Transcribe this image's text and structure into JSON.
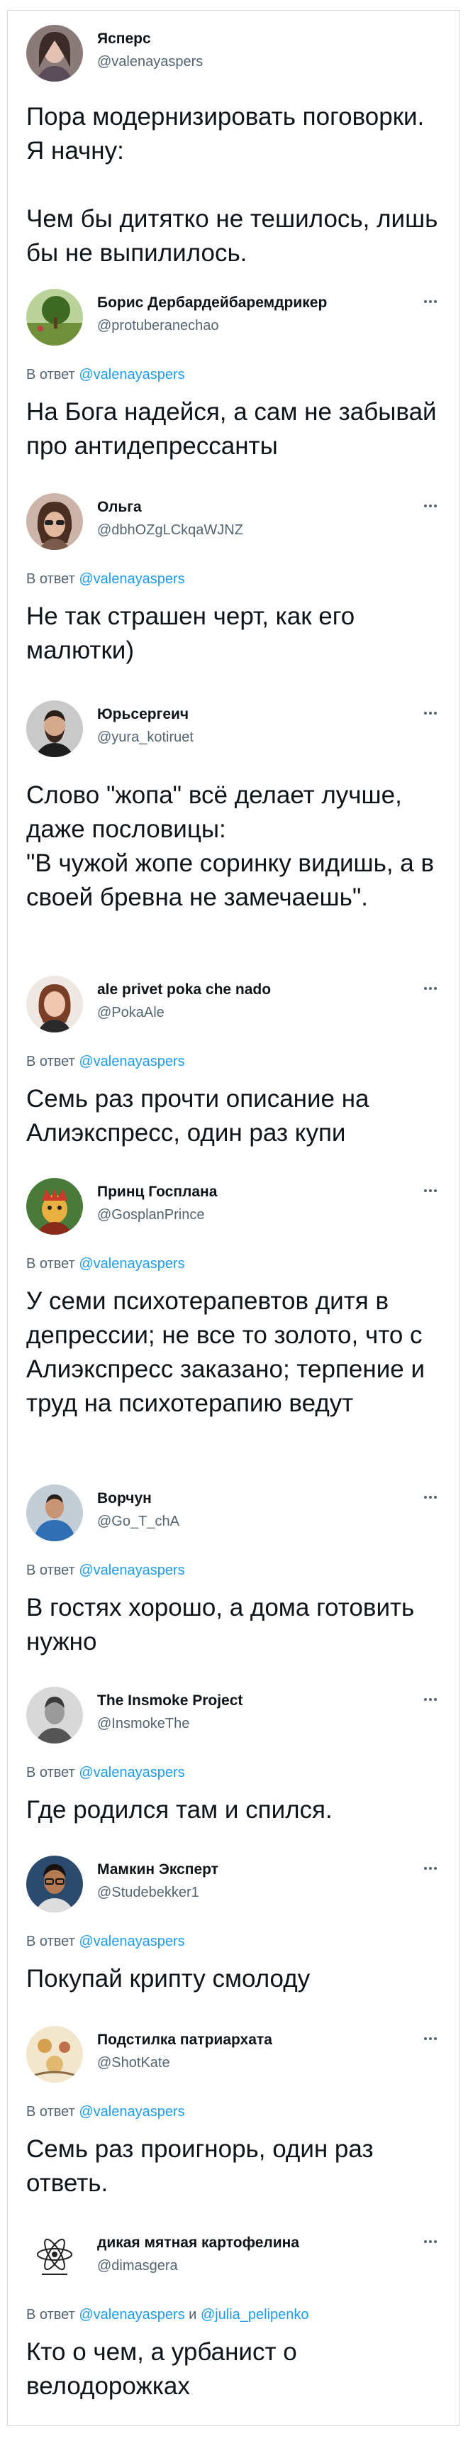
{
  "reply_prefix": "В ответ",
  "main_tweet": {
    "name": "Ясперс",
    "handle": "@valenayaspers",
    "text": "Пора модернизировать поговорки. Я начну:\n\nЧем бы дитятко не тешилось, лишь бы не выпилилось."
  },
  "replies": [
    {
      "name": "Борис Дербардейбаремдрикер",
      "handle": "@protuberanechao",
      "reply_to": "@valenayaspers",
      "text": "На Бога надейся, а сам не забывай про антидепрессанты"
    },
    {
      "name": "Ольга",
      "handle": "@dbhOZgLCkqaWJNZ",
      "reply_to": "@valenayaspers",
      "text": "Не так страшен черт, как его малютки)"
    },
    {
      "name": "Юрьсергеич",
      "handle": "@yura_kotiruet",
      "reply_to": "",
      "text": "Слово \"жопа\" всё делает лучше, даже пословицы:\n\"В чужой жопе соринку видишь, а в своей бревна не замечаешь\"."
    },
    {
      "name": "ale privet poka che nado",
      "handle": "@PokaAle",
      "reply_to": "@valenayaspers",
      "text": "Семь раз прочти описание на Алиэкспресс, один раз купи"
    },
    {
      "name": "Принц Госплана",
      "handle": "@GosplanPrince",
      "reply_to": "@valenayaspers",
      "text": "У семи психотерапевтов дитя в депрессии; не все то золото, что с Алиэкспресс заказано; терпение и труд на психотерапию ведут"
    },
    {
      "name": "Ворчун",
      "handle": "@Go_T_chA",
      "reply_to": "@valenayaspers",
      "text": "В гостях хорошо, а дома готовить нужно"
    },
    {
      "name": "The Insmoke Project",
      "handle": "@InsmokeThe",
      "reply_to": "@valenayaspers",
      "text": "Где родился там и спился."
    },
    {
      "name": "Мамкин Эксперт",
      "handle": "@Studebekker1",
      "reply_to": "@valenayaspers",
      "text": "Покупай крипту смолоду"
    },
    {
      "name": "Подстилка патриархата",
      "handle": "@ShotKate",
      "reply_to": "@valenayaspers",
      "text": "Семь раз проигнорь, один раз ответь."
    },
    {
      "name": "дикая мятная картофелина",
      "handle": "@dimasgera",
      "reply_to": "@valenayaspers",
      "reply_and": "и",
      "reply_to2": "@julia_pelipenko",
      "text": "Кто о чем, а урбанист о велодорожках"
    }
  ],
  "avatar_icons": [
    "woman-portrait-avatar",
    "tree-landscape-avatar",
    "woman-sunglasses-avatar",
    "man-beard-avatar",
    "woman-avatar",
    "cartoon-prince-avatar",
    "man-blue-shirt-avatar",
    "man-bw-avatar",
    "man-glasses-avatar",
    "pattern-avatar",
    "atom-sketch-avatar"
  ],
  "colors": {
    "text": "#0f1419",
    "secondary": "#536471",
    "link": "#1d9bf0",
    "border": "#d0d6da"
  }
}
